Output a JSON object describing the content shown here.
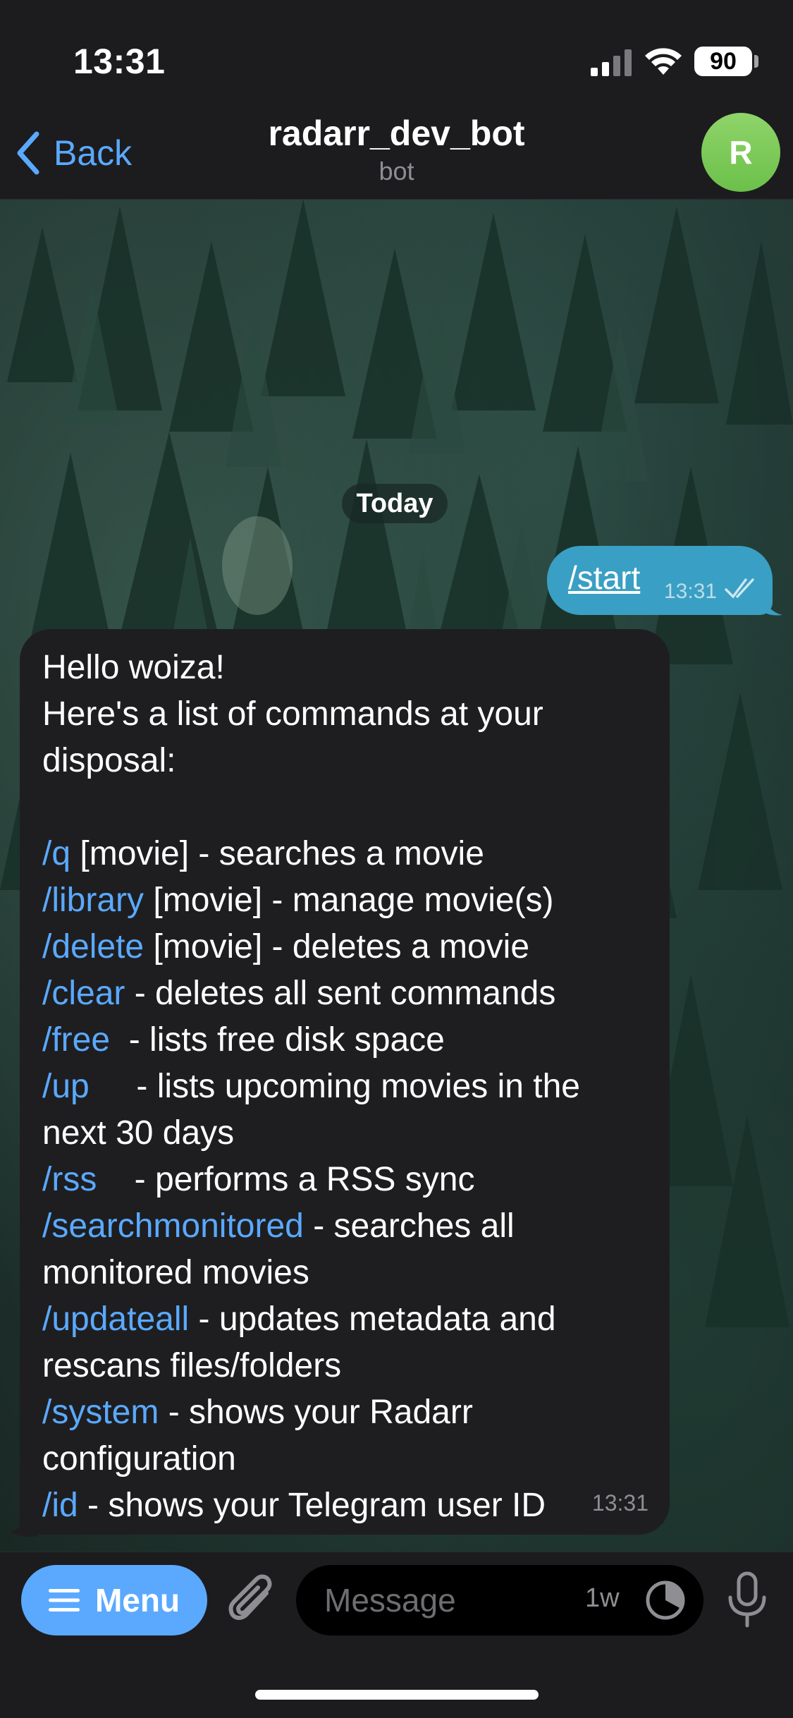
{
  "status_bar": {
    "time": "13:31",
    "battery": "90"
  },
  "header": {
    "back_label": "Back",
    "title": "radarr_dev_bot",
    "subtitle": "bot",
    "avatar_letter": "R"
  },
  "chat": {
    "date_chip": "Today",
    "outgoing": {
      "text": "/start",
      "time": "13:31"
    },
    "incoming": {
      "intro": "Hello woiza!\nHere's a list of commands at your\ndisposal:",
      "commands": [
        {
          "cmd": "/q",
          "desc": " [movie] - searches a movie"
        },
        {
          "cmd": "/library",
          "desc": " [movie] - manage movie(s)"
        },
        {
          "cmd": "/delete",
          "desc": " [movie] - deletes a movie"
        },
        {
          "cmd": "/clear",
          "desc": " - deletes all sent commands"
        },
        {
          "cmd": "/free",
          "desc": "  - lists free disk space"
        },
        {
          "cmd": "/up",
          "desc": "     - lists upcoming movies in the\nnext 30 days"
        },
        {
          "cmd": "/rss",
          "desc": "    - performs a RSS sync"
        },
        {
          "cmd": "/searchmonitored",
          "desc": " - searches all\nmonitored movies"
        },
        {
          "cmd": "/updateall",
          "desc": " - updates metadata and\nrescans files/folders"
        },
        {
          "cmd": "/system",
          "desc": " - shows your Radarr\nconfiguration"
        },
        {
          "cmd": "/id",
          "desc": " - shows your Telegram user ID"
        }
      ],
      "time": "13:31"
    }
  },
  "input_bar": {
    "menu_label": "Menu",
    "placeholder": "Message",
    "timer_label": "1w"
  },
  "colors": {
    "accent": "#5aa9ff",
    "outgoing_bubble": "#3a9fc4",
    "incoming_bubble": "#1e1e20",
    "avatar": "#7fcb5a"
  }
}
